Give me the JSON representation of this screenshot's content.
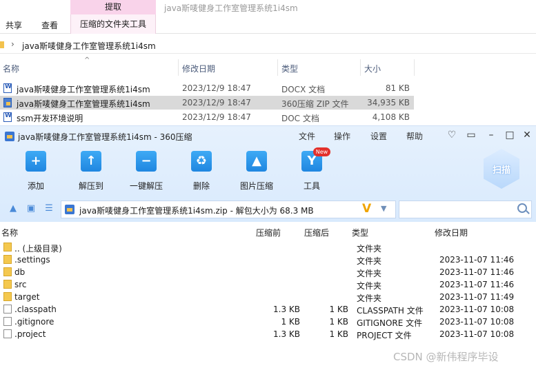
{
  "explorer": {
    "context_tab_header": "提取",
    "window_title": "java斯唛健身工作室管理系统1i4sm",
    "ribbon_tabs": [
      "共享",
      "查看"
    ],
    "context_tab": "压缩的文件夹工具",
    "address_path": "java斯唛健身工作室管理系统1i4sm",
    "columns": {
      "name": "名称",
      "date": "修改日期",
      "type": "类型",
      "size": "大小"
    },
    "files": [
      {
        "name": "java斯唛健身工作室管理系统1i4sm",
        "date": "2023/12/9 18:47",
        "type": "DOCX 文档",
        "size": "81 KB",
        "icon": "word-doc-icon"
      },
      {
        "name": "java斯唛健身工作室管理系统1i4sm",
        "date": "2023/12/9 18:47",
        "type": "360压缩 ZIP 文件",
        "size": "34,935 KB",
        "icon": "zip-archive-icon",
        "selected": true
      },
      {
        "name": "ssm开发环境说明",
        "date": "2023/12/9 18:47",
        "type": "DOC 文档",
        "size": "4,108 KB",
        "icon": "word-doc-icon"
      }
    ]
  },
  "zip": {
    "title": "java斯唛健身工作室管理系统1i4sm - 360压缩",
    "menu": [
      "文件",
      "操作",
      "设置",
      "帮助"
    ],
    "toolbar": [
      {
        "label": "添加",
        "icon": "add-icon"
      },
      {
        "label": "解压到",
        "icon": "extract-to-icon"
      },
      {
        "label": "一键解压",
        "icon": "one-click-extract-icon"
      },
      {
        "label": "删除",
        "icon": "delete-icon"
      },
      {
        "label": "图片压缩",
        "icon": "image-compress-icon"
      },
      {
        "label": "工具",
        "icon": "tools-icon"
      }
    ],
    "new_badge": "New",
    "scan_label": "扫描",
    "path": "java斯唛健身工作室管理系统1i4sm.zip - 解包大小为 68.3 MB",
    "search_placeholder": "",
    "columns": {
      "name": "名称",
      "compressed": "压缩前",
      "packed": "压缩后",
      "type": "类型",
      "date": "修改日期"
    },
    "rows": [
      {
        "name": ".. (上级目录)",
        "compressed": "",
        "packed": "",
        "type": "文件夹",
        "date": "",
        "kind": "folder"
      },
      {
        "name": ".settings",
        "compressed": "",
        "packed": "",
        "type": "文件夹",
        "date": "2023-11-07 11:46",
        "kind": "folder"
      },
      {
        "name": "db",
        "compressed": "",
        "packed": "",
        "type": "文件夹",
        "date": "2023-11-07 11:46",
        "kind": "folder"
      },
      {
        "name": "src",
        "compressed": "",
        "packed": "",
        "type": "文件夹",
        "date": "2023-11-07 11:46",
        "kind": "folder"
      },
      {
        "name": "target",
        "compressed": "",
        "packed": "",
        "type": "文件夹",
        "date": "2023-11-07 11:49",
        "kind": "folder"
      },
      {
        "name": ".classpath",
        "compressed": "1.3 KB",
        "packed": "1 KB",
        "type": "CLASSPATH 文件",
        "date": "2023-11-07 10:08",
        "kind": "file"
      },
      {
        "name": ".gitignore",
        "compressed": "1 KB",
        "packed": "1 KB",
        "type": "GITIGNORE 文件",
        "date": "2023-11-07 10:08",
        "kind": "file"
      },
      {
        "name": ".project",
        "compressed": "1.3 KB",
        "packed": "1 KB",
        "type": "PROJECT 文件",
        "date": "2023-11-07 10:08",
        "kind": "file"
      }
    ]
  },
  "watermark": "CSDN @新伟程序毕设"
}
